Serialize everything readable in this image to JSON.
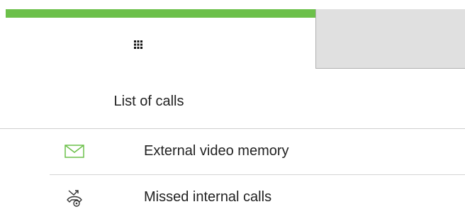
{
  "tabs": {
    "keypad_icon": "grid-icon",
    "accent_color": "#6cc04a"
  },
  "list": {
    "title": "List of calls",
    "items": [
      {
        "label": "External video memory",
        "icon": "envelope-icon"
      },
      {
        "label": "Missed internal calls",
        "icon": "missed-call-icon"
      }
    ]
  }
}
